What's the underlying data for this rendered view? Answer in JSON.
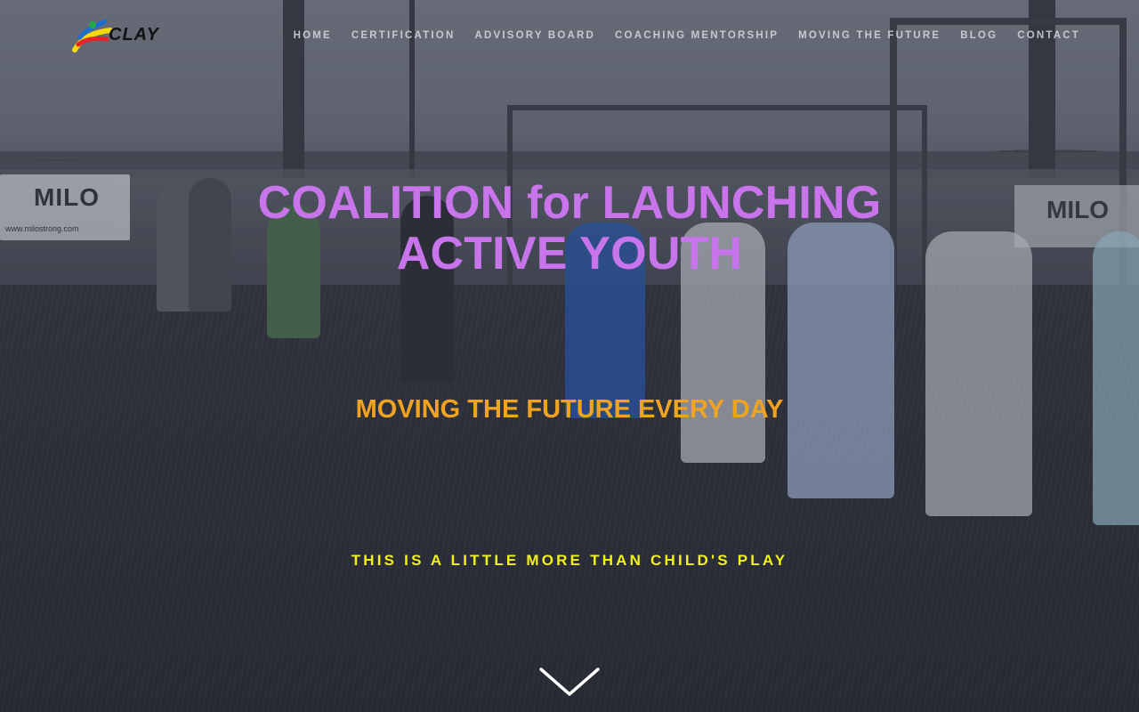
{
  "header": {
    "logo_text": "CLAY",
    "nav": [
      {
        "label": "HOME"
      },
      {
        "label": "CERTIFICATION"
      },
      {
        "label": "ADVISORY BOARD"
      },
      {
        "label": "COACHING MENTORSHIP"
      },
      {
        "label": "MOVING THE FUTURE"
      },
      {
        "label": "BLOG"
      },
      {
        "label": "CONTACT"
      }
    ]
  },
  "hero": {
    "title_line1": "COALITION for LAUNCHING",
    "title_line2": "ACTIVE YOUTH",
    "tagline": "MOVING THE FUTURE EVERY DAY",
    "subline": "THIS IS A LITTLE MORE THAN CHILD'S PLAY",
    "scroll_icon": "chevron-down-icon",
    "background_signs": {
      "left": "MILO",
      "left_small": "www.milostrong.com",
      "right": "MILO"
    }
  },
  "colors": {
    "title": "#c874ea",
    "tagline": "#f0a321",
    "subline": "#f1f21b",
    "nav": "#d7dae2",
    "logo_blue": "#1b6fd1",
    "logo_yellow": "#f5d90a",
    "logo_red": "#e0262a",
    "logo_green": "#2aa64a"
  }
}
